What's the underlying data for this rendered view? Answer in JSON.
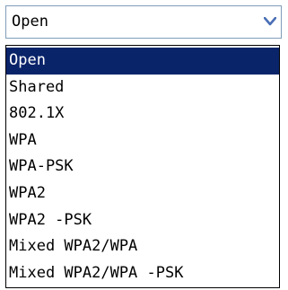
{
  "select": {
    "value": "Open",
    "arrow_icon": "chevron-down-icon",
    "arrow_color": "#4a6fb5"
  },
  "dropdown": {
    "selected_index": 0,
    "highlight_color": "#0a246a",
    "options": [
      "Open",
      "Shared",
      "802.1X",
      "WPA",
      "WPA-PSK",
      "WPA2",
      "WPA2 -PSK",
      "Mixed WPA2/WPA",
      "Mixed WPA2/WPA -PSK"
    ]
  }
}
